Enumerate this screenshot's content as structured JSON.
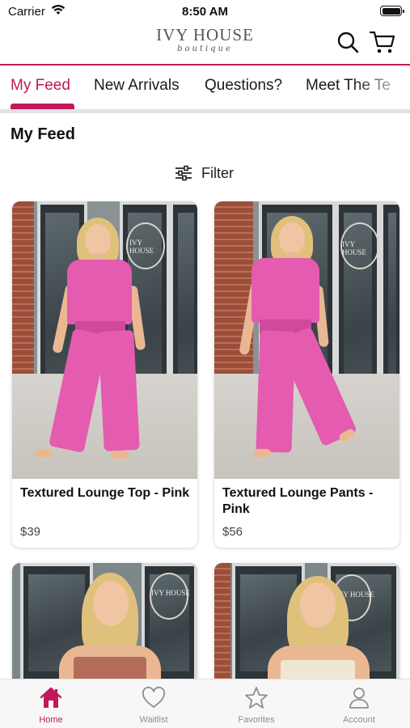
{
  "status_bar": {
    "carrier": "Carrier",
    "time": "8:50 AM"
  },
  "header": {
    "brand": "IVY HOUSE",
    "brand_sub": "boutique"
  },
  "tabs": [
    {
      "label": "My Feed",
      "active": true
    },
    {
      "label": "New Arrivals",
      "active": false
    },
    {
      "label": "Questions?",
      "active": false
    },
    {
      "label": "Meet The Te",
      "active": false
    }
  ],
  "page": {
    "title": "My Feed",
    "filter_label": "Filter"
  },
  "products": [
    {
      "name": "Textured Lounge Top - Pink",
      "price": "$39"
    },
    {
      "name": "Textured Lounge Pants - Pink",
      "price": "$56"
    }
  ],
  "tab_bar": [
    {
      "label": "Home",
      "icon": "home-icon",
      "active": true
    },
    {
      "label": "Waitlist",
      "icon": "heart-icon",
      "active": false
    },
    {
      "label": "Favorites",
      "icon": "star-icon",
      "active": false
    },
    {
      "label": "Account",
      "icon": "person-icon",
      "active": false
    }
  ],
  "colors": {
    "accent": "#c2185b",
    "product_pink": "#e45bb0",
    "inactive": "#8e8e93"
  }
}
